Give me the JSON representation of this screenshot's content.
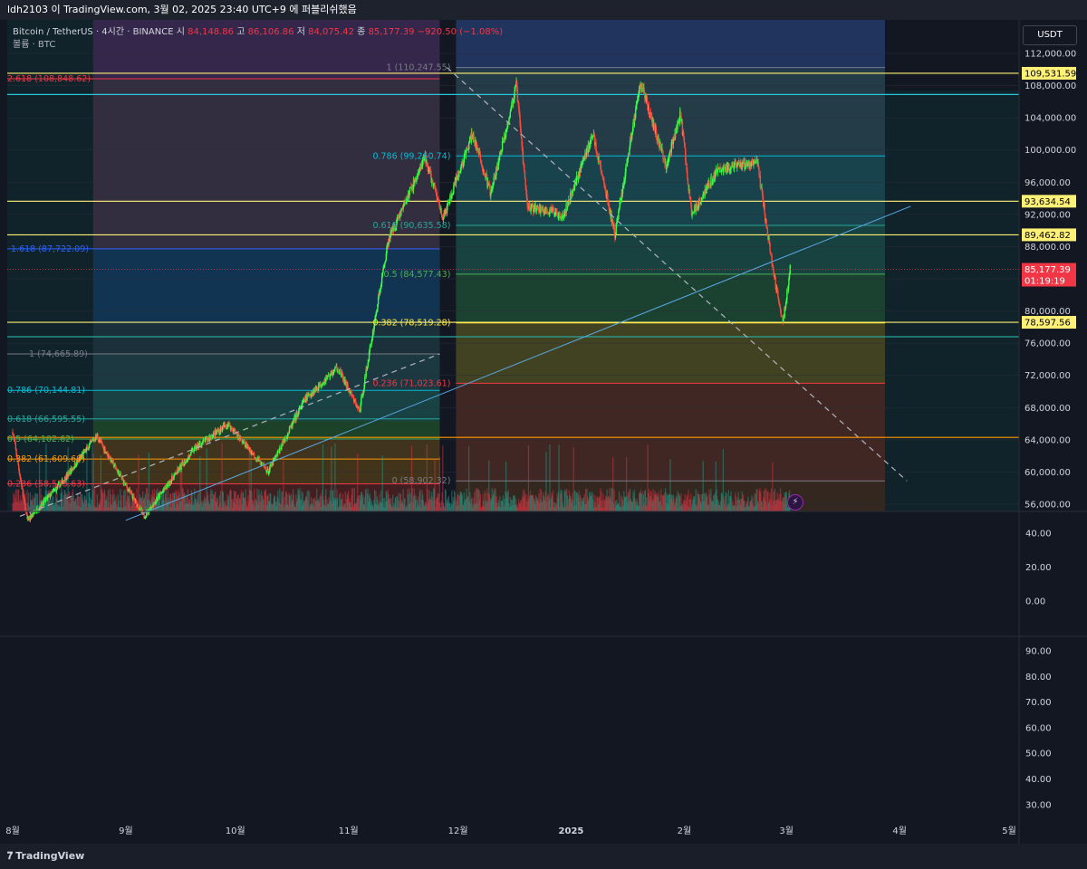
{
  "header": {
    "title": "ldh2103 이 TradingView.com, 3월 02, 2025 23:40 UTC+9 에 퍼블리쉬했음"
  },
  "legend": {
    "symbol": "Bitcoin / TetherUS · 4시간 · BINANCE",
    "open_label": "시",
    "open_value": "84,148.86",
    "high_label": "고",
    "high_value": "86,106.86",
    "low_label": "저",
    "low_value": "84,075.42",
    "close_label": "종",
    "close_value": "85,177.39",
    "change": "−920.50 (−1.08%)",
    "volume": "볼륨 · BTC"
  },
  "price_axis": {
    "unit": "USDT",
    "ticks": [
      "112,000.00",
      "108,000.00",
      "104,000.00",
      "100,000.00",
      "96,000.00",
      "92,000.00",
      "88,000.00",
      "84,000.00",
      "80,000.00",
      "76,000.00",
      "72,000.00",
      "68,000.00",
      "64,000.00",
      "60,000.00",
      "56,000.00"
    ],
    "badges": [
      {
        "price": 109531.59,
        "text": "109,531.59",
        "bg": "#fff176",
        "fg": "#000000"
      },
      {
        "price": 93634.54,
        "text": "93,634.54",
        "bg": "#fff176",
        "fg": "#000000"
      },
      {
        "price": 89462.82,
        "text": "89,462.82",
        "bg": "#fff176",
        "fg": "#000000"
      },
      {
        "price": 78597.56,
        "text": "78,597.56",
        "bg": "#fff176",
        "fg": "#000000"
      }
    ],
    "current": {
      "price": 85177.39,
      "text": "85,177.39",
      "countdown": "01:19:19",
      "bg": "#f23645",
      "fg": "#ffffff"
    }
  },
  "indicator1": {
    "ticks": [
      "40.00",
      "20.00",
      "0.00"
    ]
  },
  "indicator2": {
    "ticks": [
      "90.00",
      "80.00",
      "70.00",
      "60.00",
      "50.00",
      "40.00",
      "30.00"
    ]
  },
  "time_axis": {
    "labels": [
      "8월",
      "9월",
      "10월",
      "11월",
      "12월",
      "2025",
      "2월",
      "3월",
      "4월",
      "5월"
    ]
  },
  "fib_left": {
    "start_label": "2024-08-01",
    "levels": [
      {
        "ratio": "2.618",
        "price": 108848.62,
        "text": "2.618 (108,848.62)",
        "color": "#f23645"
      },
      {
        "ratio": "1.618",
        "price": 87722.09,
        "text": "1.618 (87,722.09)",
        "color": "#2962ff"
      },
      {
        "ratio": "1",
        "price": 74665.89,
        "text": "1 (74,665.89)",
        "color": "#787b86"
      },
      {
        "ratio": "0.786",
        "price": 70144.81,
        "text": "0.786 (70,144.81)",
        "color": "#00bcd4"
      },
      {
        "ratio": "0.618",
        "price": 66595.55,
        "text": "0.618 (66,595.55)",
        "color": "#26a69a"
      },
      {
        "ratio": "0.5",
        "price": 64102.62,
        "text": "0.5 (64,102.62)",
        "color": "#4caf50"
      },
      {
        "ratio": "0.382",
        "price": 61609.69,
        "text": "0.382 (61,609.69)",
        "color": "#ff9800"
      },
      {
        "ratio": "0.236",
        "price": 58525.63,
        "text": "0.236 (58,525.63)",
        "color": "#f23645"
      }
    ]
  },
  "fib_right": {
    "levels": [
      {
        "ratio": "1",
        "price": 110247.55,
        "text": "1 (110,247.55)",
        "color": "#787b86"
      },
      {
        "ratio": "0.786",
        "price": 99260.74,
        "text": "0.786 (99,260.74)",
        "color": "#00bcd4"
      },
      {
        "ratio": "0.618",
        "price": 90635.58,
        "text": "0.618 (90,635.58)",
        "color": "#26a69a"
      },
      {
        "ratio": "0.5",
        "price": 84577.43,
        "text": "0.5 (84,577.43)",
        "color": "#4caf50"
      },
      {
        "ratio": "0.382",
        "price": 78519.28,
        "text": "0.382 (78,519.28)",
        "color": "#ffeb3b"
      },
      {
        "ratio": "0.236",
        "price": 71023.61,
        "text": "0.236 (71,023.61)",
        "color": "#f23645"
      },
      {
        "ratio": "0",
        "price": 58902.32,
        "text": "0 (58,902.32)",
        "color": "#787b86"
      }
    ]
  },
  "horizontal_lines": [
    {
      "price": 109531.59,
      "color": "#fff176"
    },
    {
      "price": 106900,
      "color": "#26c6da"
    },
    {
      "price": 93634.54,
      "color": "#fff176"
    },
    {
      "price": 89462.82,
      "color": "#fff176"
    },
    {
      "price": 78597.56,
      "color": "#fff176"
    },
    {
      "price": 76800,
      "color": "#26a69a"
    },
    {
      "price": 64300,
      "color": "#ff9800"
    }
  ],
  "chart_data": {
    "type": "candlestick",
    "title": "Bitcoin / TetherUS · 4시간 · BINANCE",
    "ylabel": "USDT",
    "ylim": [
      55000,
      114000
    ],
    "x_range": [
      "2024-08-01",
      "2025-05-02"
    ],
    "price_path": [
      {
        "date": "2024-08-01",
        "price": 65000
      },
      {
        "date": "2024-08-05",
        "price": 54000
      },
      {
        "date": "2024-08-15",
        "price": 59000
      },
      {
        "date": "2024-08-24",
        "price": 64500
      },
      {
        "date": "2024-09-06",
        "price": 54500
      },
      {
        "date": "2024-09-20",
        "price": 63000
      },
      {
        "date": "2024-09-29",
        "price": 66000
      },
      {
        "date": "2024-10-10",
        "price": 60000
      },
      {
        "date": "2024-10-20",
        "price": 69000
      },
      {
        "date": "2024-10-29",
        "price": 73000
      },
      {
        "date": "2024-11-04",
        "price": 67500
      },
      {
        "date": "2024-11-12",
        "price": 89000
      },
      {
        "date": "2024-11-22",
        "price": 99000
      },
      {
        "date": "2024-11-27",
        "price": 91500
      },
      {
        "date": "2024-12-05",
        "price": 102000
      },
      {
        "date": "2024-12-10",
        "price": 94500
      },
      {
        "date": "2024-12-17",
        "price": 108000
      },
      {
        "date": "2024-12-20",
        "price": 93000
      },
      {
        "date": "2024-12-30",
        "price": 92000
      },
      {
        "date": "2025-01-07",
        "price": 102000
      },
      {
        "date": "2025-01-13",
        "price": 89500
      },
      {
        "date": "2025-01-20",
        "price": 108500
      },
      {
        "date": "2025-01-27",
        "price": 98000
      },
      {
        "date": "2025-01-31",
        "price": 104500
      },
      {
        "date": "2025-02-03",
        "price": 92000
      },
      {
        "date": "2025-02-10",
        "price": 97500
      },
      {
        "date": "2025-02-21",
        "price": 98500
      },
      {
        "date": "2025-02-25",
        "price": 86000
      },
      {
        "date": "2025-02-28",
        "price": 78500
      },
      {
        "date": "2025-03-02",
        "price": 85177.39
      }
    ],
    "volume_ylim": [
      0,
      100000
    ],
    "rsi_ticks": [
      30,
      40,
      50,
      60,
      70,
      80,
      90
    ]
  }
}
